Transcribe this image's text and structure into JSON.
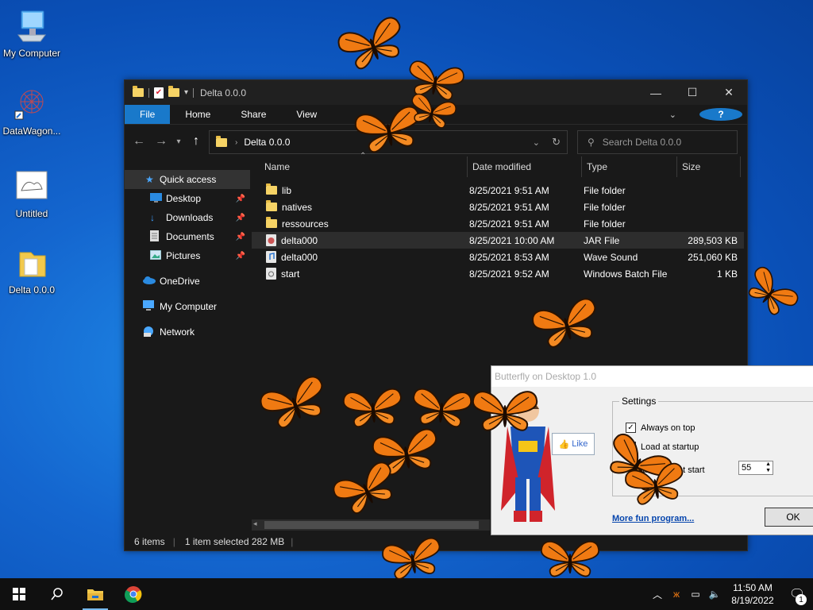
{
  "desktop": {
    "icons": [
      {
        "label": "My Computer"
      },
      {
        "label": "DataWagon..."
      },
      {
        "label": "Untitled"
      },
      {
        "label": "Delta 0.0.0"
      }
    ]
  },
  "explorer": {
    "title": "Delta 0.0.0",
    "ribbon": {
      "file": "File",
      "home": "Home",
      "share": "Share",
      "view": "View",
      "help": "?"
    },
    "address": "Delta 0.0.0",
    "search_placeholder": "Search Delta 0.0.0",
    "nav": {
      "quick_access": "Quick access",
      "desktop": "Desktop",
      "downloads": "Downloads",
      "documents": "Documents",
      "pictures": "Pictures",
      "onedrive": "OneDrive",
      "my_computer": "My Computer",
      "network": "Network"
    },
    "columns": {
      "name": "Name",
      "date": "Date modified",
      "type": "Type",
      "size": "Size"
    },
    "files": [
      {
        "name": "lib",
        "date": "8/25/2021 9:51 AM",
        "type": "File folder",
        "size": "",
        "icon": "folder-icon"
      },
      {
        "name": "natives",
        "date": "8/25/2021 9:51 AM",
        "type": "File folder",
        "size": "",
        "icon": "folder-icon"
      },
      {
        "name": "ressources",
        "date": "8/25/2021 9:51 AM",
        "type": "File folder",
        "size": "",
        "icon": "folder-icon"
      },
      {
        "name": "delta000",
        "date": "8/25/2021 10:00 AM",
        "type": "JAR File",
        "size": "289,503 KB",
        "icon": "jar-file-icon"
      },
      {
        "name": "delta000",
        "date": "8/25/2021 8:53 AM",
        "type": "Wave Sound",
        "size": "251,060 KB",
        "icon": "audio-file-icon"
      },
      {
        "name": "start",
        "date": "8/25/2021 9:52 AM",
        "type": "Windows Batch File",
        "size": "1 KB",
        "icon": "batch-file-icon"
      }
    ],
    "status": {
      "items": "6 items",
      "selected": "1 item selected  282 MB"
    }
  },
  "dialog": {
    "title": "Butterfly on Desktop 1.0",
    "settings_legend": "Settings",
    "always_on_top": "Always on top",
    "load_at_startup": "Load at startup",
    "butterflies_at_start": "Butterflies at start",
    "butterflies_value": "55",
    "more_link": "More fun program...",
    "like": "Like",
    "ok": "OK"
  },
  "taskbar": {
    "time": "11:50 AM",
    "date": "8/19/2022",
    "notification_count": "1"
  },
  "colors": {
    "accent": "#1979ca",
    "butterfly": "#f07a12"
  }
}
